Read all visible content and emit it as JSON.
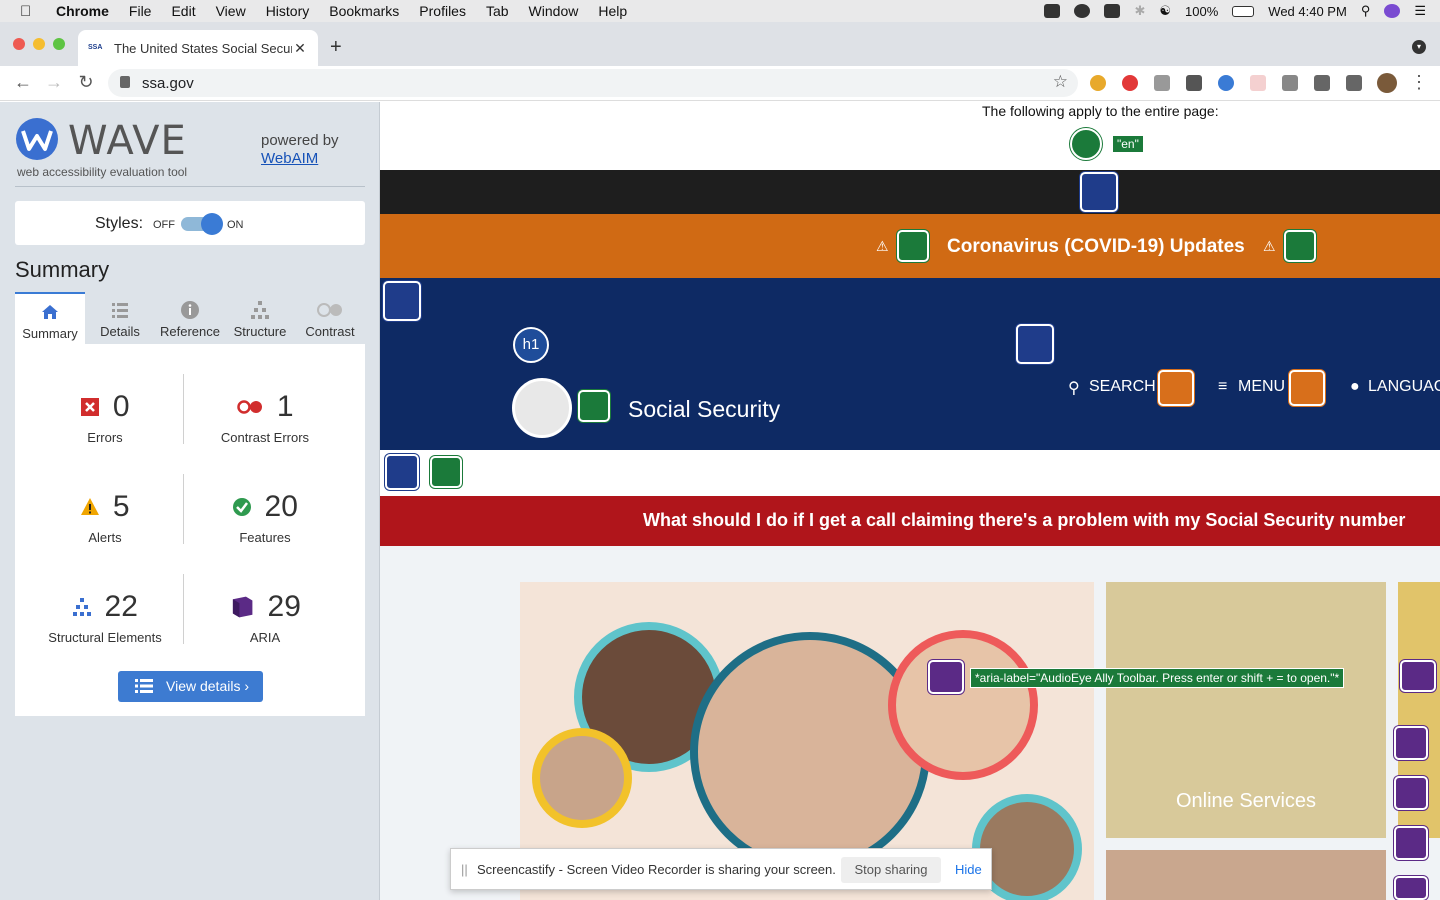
{
  "menubar": {
    "app_name": "Chrome",
    "items": [
      "File",
      "Edit",
      "View",
      "History",
      "Bookmarks",
      "Profiles",
      "Tab",
      "Window",
      "Help"
    ],
    "battery": "100%",
    "clock": "Wed 4:40 PM"
  },
  "browser": {
    "tab_title": "The United States Social Secur",
    "tab_favicon": "SSA",
    "url": "ssa.gov"
  },
  "wave": {
    "logo_word": "WAVE",
    "tagline": "web accessibility evaluation tool",
    "powered_by": "powered by",
    "webaim_link": "WebAIM",
    "styles_label": "Styles:",
    "styles_off": "OFF",
    "styles_on": "ON",
    "summary_heading": "Summary",
    "tabs": [
      {
        "label": "Summary",
        "icon": "home-icon"
      },
      {
        "label": "Details",
        "icon": "list-icon"
      },
      {
        "label": "Reference",
        "icon": "info-icon"
      },
      {
        "label": "Structure",
        "icon": "structure-icon"
      },
      {
        "label": "Contrast",
        "icon": "contrast-icon"
      }
    ],
    "stats": {
      "errors": {
        "value": "0",
        "label": "Errors"
      },
      "contrast_errors": {
        "value": "1",
        "label": "Contrast Errors"
      },
      "alerts": {
        "value": "5",
        "label": "Alerts"
      },
      "features": {
        "value": "20",
        "label": "Features"
      },
      "structural": {
        "value": "22",
        "label": "Structural Elements"
      },
      "aria": {
        "value": "29",
        "label": "ARIA"
      }
    },
    "view_details": "View details ›"
  },
  "page": {
    "apply_text": "The following apply to the entire page:",
    "lang_badge": "\"en\"",
    "covid_text": "Coronavirus (COVID-19) Updates",
    "h1_badge": "h1",
    "site_title": "Social Security",
    "search": "SEARCH",
    "menu": "MENU",
    "language": "LANGUAG",
    "alert_banner": "What should I do if I get a call claiming there's a problem with my Social Security number",
    "online_services": "Online Services",
    "aria_label": "*aria-label=\"AudioEye Ally Toolbar. Press enter or shift + = to open.\"*"
  },
  "screencast": {
    "text": "Screencastify - Screen Video Recorder is sharing your screen.",
    "stop": "Stop sharing",
    "hide": "Hide"
  },
  "colors": {
    "wave_blue": "#3d7bd1",
    "covid_orange": "#d06a14",
    "ssa_navy": "#0e2a64",
    "alert_red": "#b0151b",
    "feature_green": "#1b7a3a",
    "aria_purple": "#5b2a86"
  }
}
